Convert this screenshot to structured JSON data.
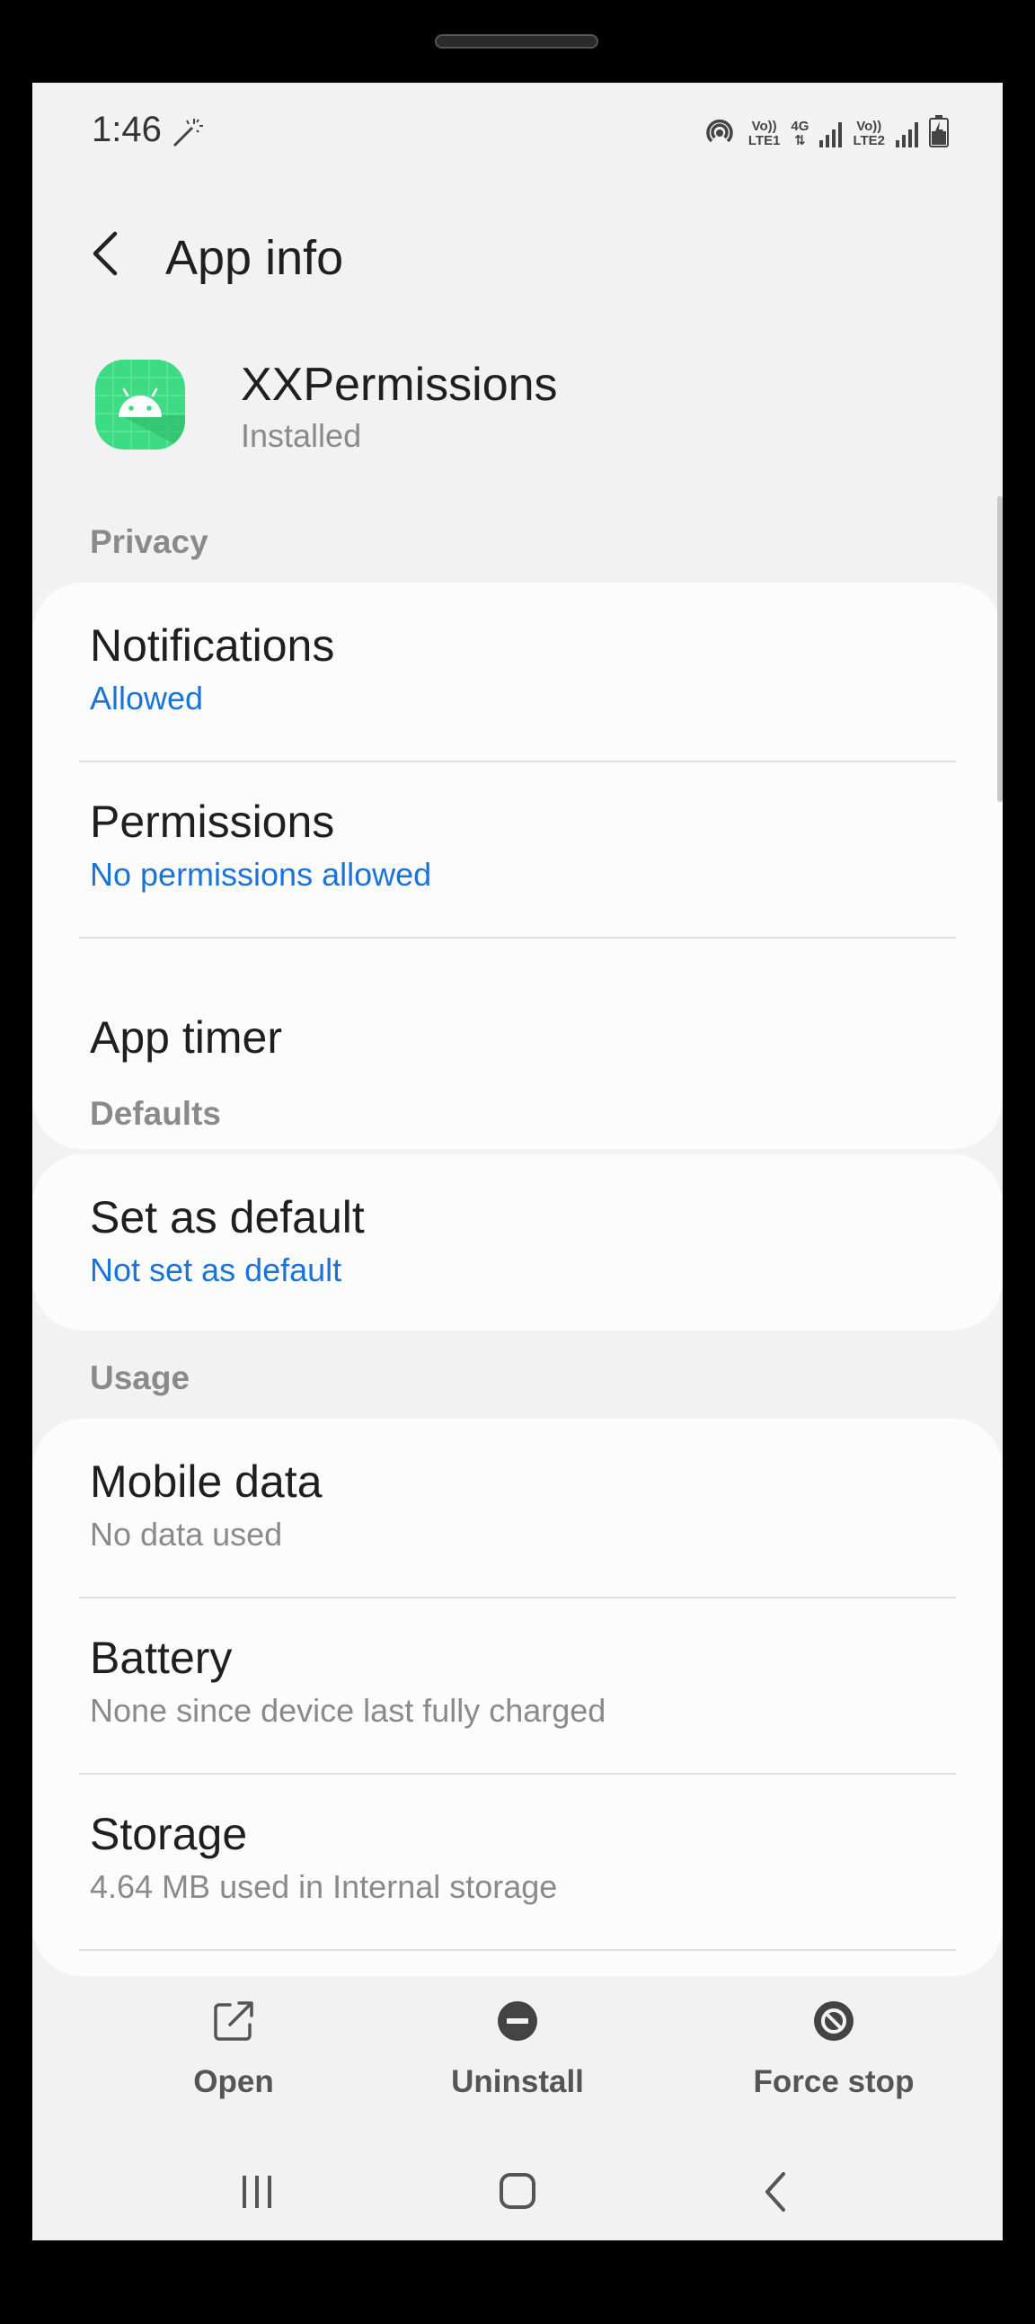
{
  "status_bar": {
    "time": "1:46",
    "sim1_label_top": "Vo))",
    "sim1_label_bottom": "LTE1",
    "network_type": "4G",
    "sim2_label_top": "Vo))",
    "sim2_label_bottom": "LTE2"
  },
  "header": {
    "title": "App info"
  },
  "app": {
    "name": "XXPermissions",
    "status": "Installed",
    "icon_color": "#3ddc84"
  },
  "sections": {
    "privacy": {
      "label": "Privacy",
      "items": [
        {
          "title": "Notifications",
          "subtitle": "Allowed"
        },
        {
          "title": "Permissions",
          "subtitle": "No permissions allowed"
        },
        {
          "title": "App timer"
        }
      ]
    },
    "defaults": {
      "label": "Defaults",
      "items": [
        {
          "title": "Set as default",
          "subtitle": "Not set as default"
        }
      ]
    },
    "usage": {
      "label": "Usage",
      "items": [
        {
          "title": "Mobile data",
          "subtitle": "No data used"
        },
        {
          "title": "Battery",
          "subtitle": "None since device last fully charged"
        },
        {
          "title": "Storage",
          "subtitle": "4.64 MB used in Internal storage"
        }
      ]
    }
  },
  "actions": {
    "open": "Open",
    "uninstall": "Uninstall",
    "force_stop": "Force stop"
  },
  "colors": {
    "accent_blue": "#1a73d9",
    "background": "#f2f2f2",
    "card": "#fcfcfc"
  }
}
